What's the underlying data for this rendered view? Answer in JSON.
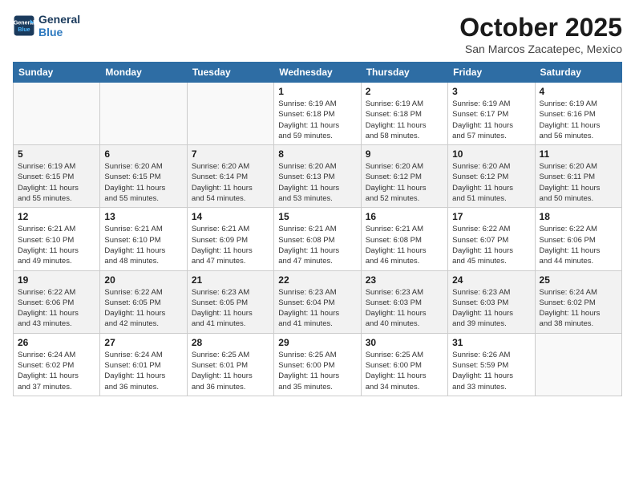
{
  "header": {
    "logo_line1": "General",
    "logo_line2": "Blue",
    "title": "October 2025",
    "subtitle": "San Marcos Zacatepec, Mexico"
  },
  "days_of_week": [
    "Sunday",
    "Monday",
    "Tuesday",
    "Wednesday",
    "Thursday",
    "Friday",
    "Saturday"
  ],
  "weeks": [
    [
      {
        "num": "",
        "info": ""
      },
      {
        "num": "",
        "info": ""
      },
      {
        "num": "",
        "info": ""
      },
      {
        "num": "1",
        "info": "Sunrise: 6:19 AM\nSunset: 6:18 PM\nDaylight: 11 hours\nand 59 minutes."
      },
      {
        "num": "2",
        "info": "Sunrise: 6:19 AM\nSunset: 6:18 PM\nDaylight: 11 hours\nand 58 minutes."
      },
      {
        "num": "3",
        "info": "Sunrise: 6:19 AM\nSunset: 6:17 PM\nDaylight: 11 hours\nand 57 minutes."
      },
      {
        "num": "4",
        "info": "Sunrise: 6:19 AM\nSunset: 6:16 PM\nDaylight: 11 hours\nand 56 minutes."
      }
    ],
    [
      {
        "num": "5",
        "info": "Sunrise: 6:19 AM\nSunset: 6:15 PM\nDaylight: 11 hours\nand 55 minutes."
      },
      {
        "num": "6",
        "info": "Sunrise: 6:20 AM\nSunset: 6:15 PM\nDaylight: 11 hours\nand 55 minutes."
      },
      {
        "num": "7",
        "info": "Sunrise: 6:20 AM\nSunset: 6:14 PM\nDaylight: 11 hours\nand 54 minutes."
      },
      {
        "num": "8",
        "info": "Sunrise: 6:20 AM\nSunset: 6:13 PM\nDaylight: 11 hours\nand 53 minutes."
      },
      {
        "num": "9",
        "info": "Sunrise: 6:20 AM\nSunset: 6:12 PM\nDaylight: 11 hours\nand 52 minutes."
      },
      {
        "num": "10",
        "info": "Sunrise: 6:20 AM\nSunset: 6:12 PM\nDaylight: 11 hours\nand 51 minutes."
      },
      {
        "num": "11",
        "info": "Sunrise: 6:20 AM\nSunset: 6:11 PM\nDaylight: 11 hours\nand 50 minutes."
      }
    ],
    [
      {
        "num": "12",
        "info": "Sunrise: 6:21 AM\nSunset: 6:10 PM\nDaylight: 11 hours\nand 49 minutes."
      },
      {
        "num": "13",
        "info": "Sunrise: 6:21 AM\nSunset: 6:10 PM\nDaylight: 11 hours\nand 48 minutes."
      },
      {
        "num": "14",
        "info": "Sunrise: 6:21 AM\nSunset: 6:09 PM\nDaylight: 11 hours\nand 47 minutes."
      },
      {
        "num": "15",
        "info": "Sunrise: 6:21 AM\nSunset: 6:08 PM\nDaylight: 11 hours\nand 47 minutes."
      },
      {
        "num": "16",
        "info": "Sunrise: 6:21 AM\nSunset: 6:08 PM\nDaylight: 11 hours\nand 46 minutes."
      },
      {
        "num": "17",
        "info": "Sunrise: 6:22 AM\nSunset: 6:07 PM\nDaylight: 11 hours\nand 45 minutes."
      },
      {
        "num": "18",
        "info": "Sunrise: 6:22 AM\nSunset: 6:06 PM\nDaylight: 11 hours\nand 44 minutes."
      }
    ],
    [
      {
        "num": "19",
        "info": "Sunrise: 6:22 AM\nSunset: 6:06 PM\nDaylight: 11 hours\nand 43 minutes."
      },
      {
        "num": "20",
        "info": "Sunrise: 6:22 AM\nSunset: 6:05 PM\nDaylight: 11 hours\nand 42 minutes."
      },
      {
        "num": "21",
        "info": "Sunrise: 6:23 AM\nSunset: 6:05 PM\nDaylight: 11 hours\nand 41 minutes."
      },
      {
        "num": "22",
        "info": "Sunrise: 6:23 AM\nSunset: 6:04 PM\nDaylight: 11 hours\nand 41 minutes."
      },
      {
        "num": "23",
        "info": "Sunrise: 6:23 AM\nSunset: 6:03 PM\nDaylight: 11 hours\nand 40 minutes."
      },
      {
        "num": "24",
        "info": "Sunrise: 6:23 AM\nSunset: 6:03 PM\nDaylight: 11 hours\nand 39 minutes."
      },
      {
        "num": "25",
        "info": "Sunrise: 6:24 AM\nSunset: 6:02 PM\nDaylight: 11 hours\nand 38 minutes."
      }
    ],
    [
      {
        "num": "26",
        "info": "Sunrise: 6:24 AM\nSunset: 6:02 PM\nDaylight: 11 hours\nand 37 minutes."
      },
      {
        "num": "27",
        "info": "Sunrise: 6:24 AM\nSunset: 6:01 PM\nDaylight: 11 hours\nand 36 minutes."
      },
      {
        "num": "28",
        "info": "Sunrise: 6:25 AM\nSunset: 6:01 PM\nDaylight: 11 hours\nand 36 minutes."
      },
      {
        "num": "29",
        "info": "Sunrise: 6:25 AM\nSunset: 6:00 PM\nDaylight: 11 hours\nand 35 minutes."
      },
      {
        "num": "30",
        "info": "Sunrise: 6:25 AM\nSunset: 6:00 PM\nDaylight: 11 hours\nand 34 minutes."
      },
      {
        "num": "31",
        "info": "Sunrise: 6:26 AM\nSunset: 5:59 PM\nDaylight: 11 hours\nand 33 minutes."
      },
      {
        "num": "",
        "info": ""
      }
    ]
  ]
}
